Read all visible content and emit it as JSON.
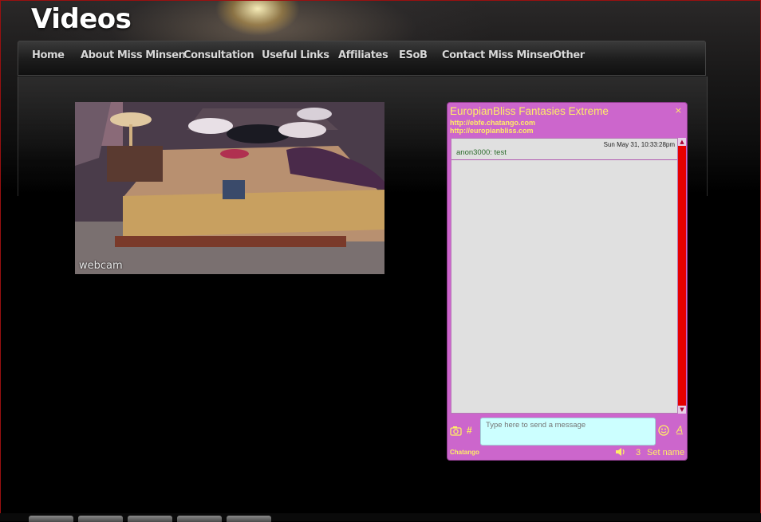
{
  "page_title": "Videos",
  "nav": {
    "items": [
      "Home",
      "About Miss Minsen",
      "Consultation",
      "Useful Links",
      "Affiliates",
      "ESoB",
      "Contact Miss Minsen",
      "Other"
    ]
  },
  "webcam": {
    "logo": "webcam"
  },
  "chat": {
    "title": "EuropianBliss Fantasies Extreme",
    "links": [
      "http://ebfe.chatango.com",
      "http://europianbliss.com"
    ],
    "close_icon": "×",
    "message": {
      "time": "Sun May 31, 10:33:28pm",
      "text": "anon3000: test"
    },
    "input_placeholder": "Type here to send a message",
    "hash_label": "#",
    "format_label": "A",
    "brand": "Chatango",
    "user_count": "3",
    "set_name": "Set name"
  },
  "colors": {
    "chat_bg": "#cc66cc",
    "chat_text": "#ffee66",
    "scrollbar": "#e60000",
    "input_bg": "#ccffff"
  }
}
